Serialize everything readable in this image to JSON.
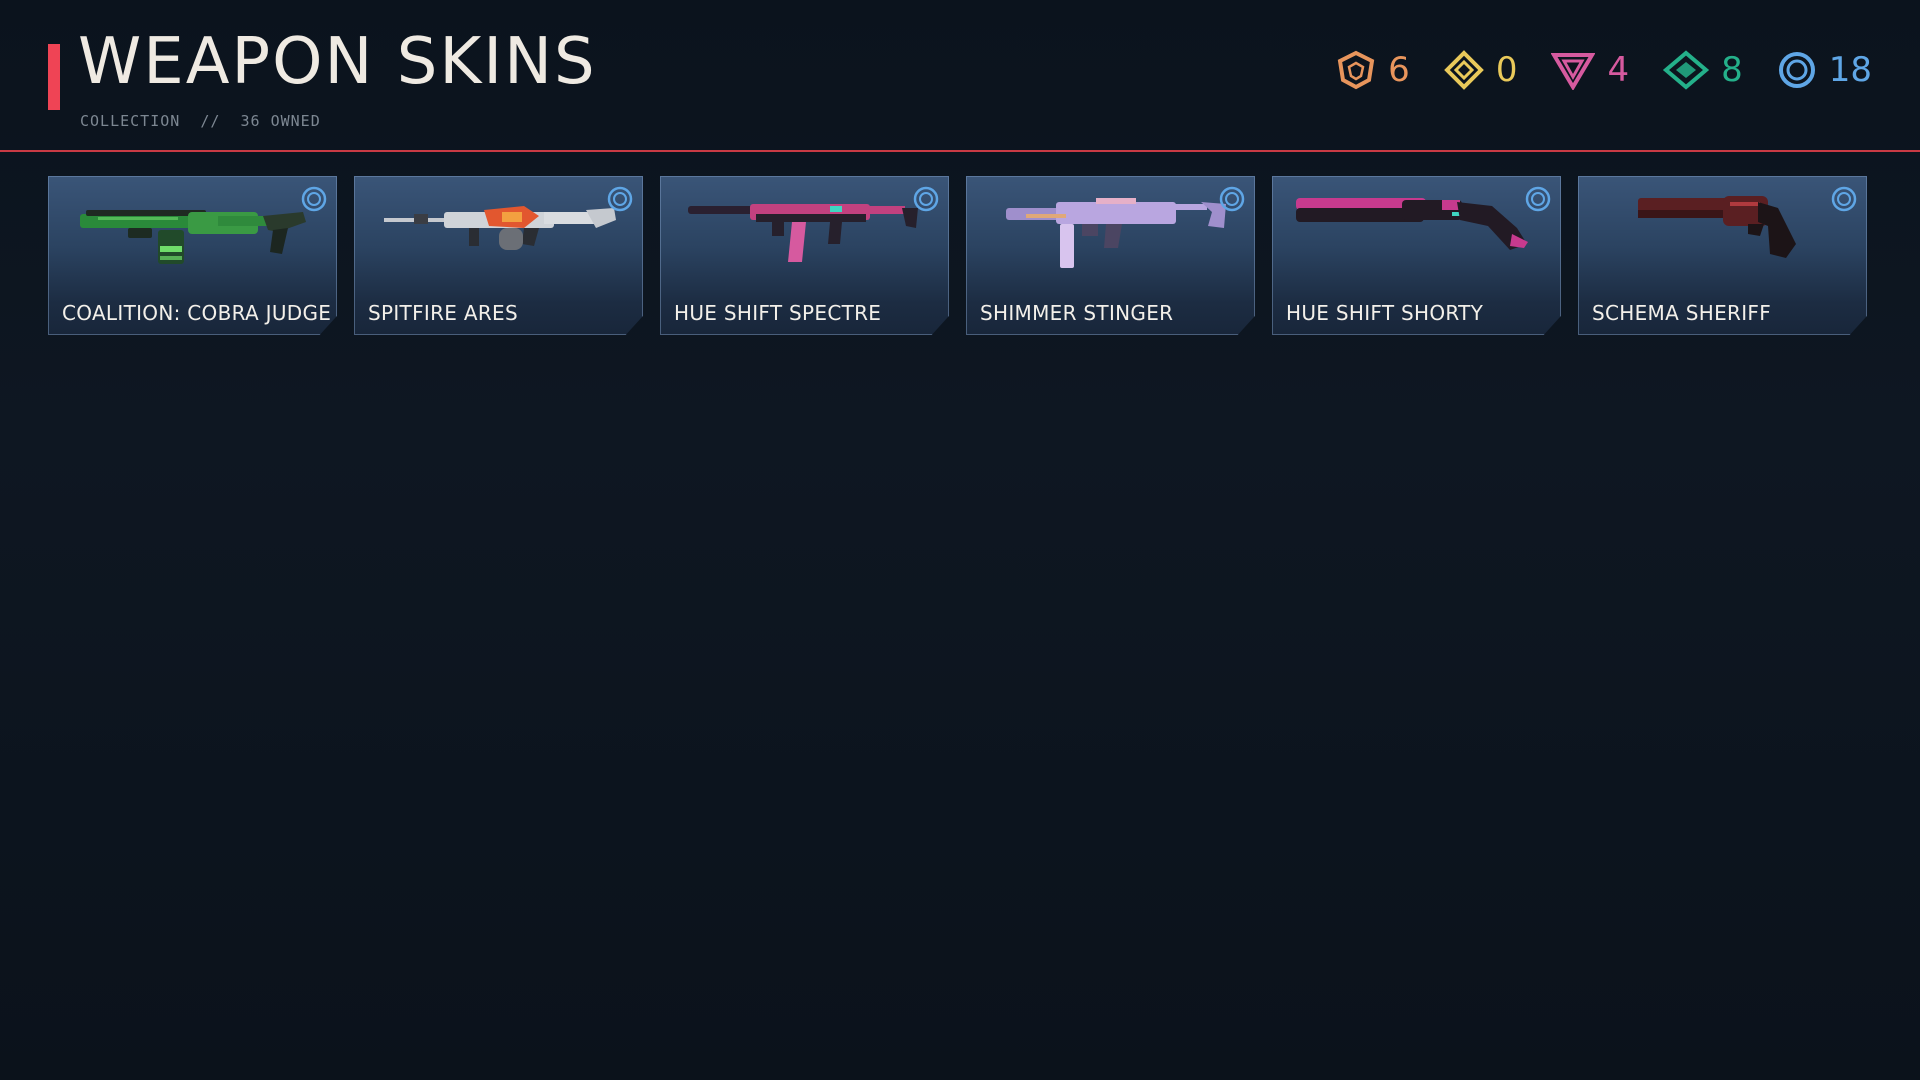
{
  "header": {
    "title": "WEAPON SKINS",
    "subtitle": "COLLECTION  //  36 OWNED",
    "accent_color": "#ef4455"
  },
  "tiers": [
    {
      "name": "select",
      "icon": "select-tier-icon",
      "count": "6",
      "color": "#e8955c"
    },
    {
      "name": "deluxe",
      "icon": "deluxe-tier-icon",
      "count": "0",
      "color": "#e9c95a"
    },
    {
      "name": "premium",
      "icon": "premium-tier-icon",
      "count": "4",
      "color": "#d65a9f"
    },
    {
      "name": "exclusive",
      "icon": "exclusive-tier-icon",
      "count": "8",
      "color": "#24b08a"
    },
    {
      "name": "ultra",
      "icon": "ultra-tier-icon",
      "count": "18",
      "color": "#5fa6e6"
    }
  ],
  "skins": [
    {
      "name": "COALITION: COBRA JUDGE",
      "tier_icon": "ultra-tier-icon",
      "primary": "#2f8a3c",
      "accent": "#6fdc6a",
      "dark": "#1d2b22"
    },
    {
      "name": "SPITFIRE ARES",
      "tier_icon": "ultra-tier-icon",
      "primary": "#cfd3d8",
      "accent": "#e2572f",
      "dark": "#2a2d33"
    },
    {
      "name": "HUE SHIFT SPECTRE",
      "tier_icon": "ultra-tier-icon",
      "primary": "#c2417f",
      "accent": "#3fd6c2",
      "dark": "#26202c"
    },
    {
      "name": "SHIMMER STINGER",
      "tier_icon": "ultra-tier-icon",
      "primary": "#b9a6e0",
      "accent": "#e6b0c8",
      "dark": "#4b4562"
    },
    {
      "name": "HUE SHIFT SHORTY",
      "tier_icon": "ultra-tier-icon",
      "primary": "#c73a8e",
      "accent": "#3fd6c2",
      "dark": "#221a24"
    },
    {
      "name": "SCHEMA SHERIFF",
      "tier_icon": "ultra-tier-icon",
      "primary": "#5a1f22",
      "accent": "#b03a3e",
      "dark": "#1c1417"
    }
  ]
}
